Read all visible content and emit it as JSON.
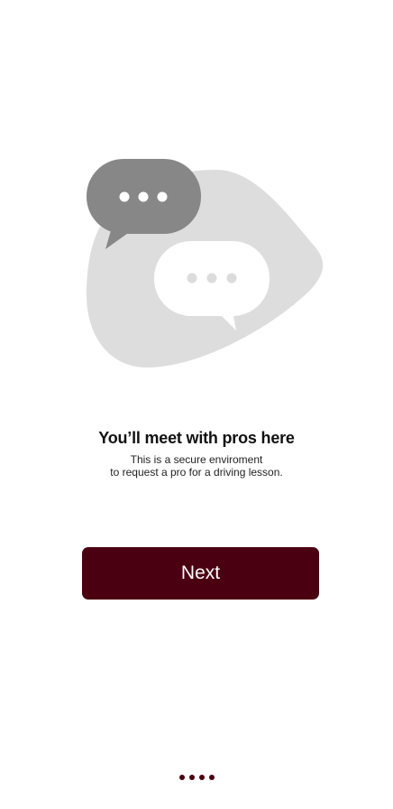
{
  "onboarding": {
    "title": "You’ll meet with pros here",
    "subtitle_lines": [
      "This is a secure enviroment",
      "to request a pro for a driving lesson."
    ],
    "next_label": "Next"
  },
  "pager": {
    "total": 4,
    "active_color": "#4b0012"
  },
  "illustration": {
    "icon": "chat-bubbles-illustration",
    "blob_color": "#dddddd",
    "dark_bubble_color": "#878787",
    "light_bubble_color": "#ffffff"
  },
  "colors": {
    "brand": "#4b0012",
    "background": "#ffffff"
  }
}
